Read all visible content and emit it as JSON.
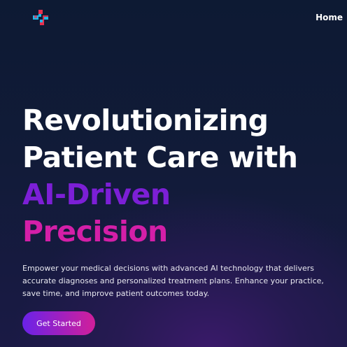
{
  "header": {
    "logo_icon": "medical-cross-logo-icon",
    "nav": {
      "home_label": "Home"
    }
  },
  "hero": {
    "headline_lines": [
      "Revolutionizing",
      "Patient Care with",
      "AI-Driven",
      "Precision"
    ],
    "description": "Empower your medical decisions with advanced AI technology that delivers accurate diagnoses and personalized treatment plans. Enhance your practice, save time, and improve patient outcomes today.",
    "cta_label": "Get Started"
  },
  "colors": {
    "background": "#101a36",
    "accent_violet": "#7c1fd6",
    "accent_magenta": "#d41fa8",
    "logo_cyan": "#1fb6e8",
    "logo_red": "#e8304f"
  }
}
